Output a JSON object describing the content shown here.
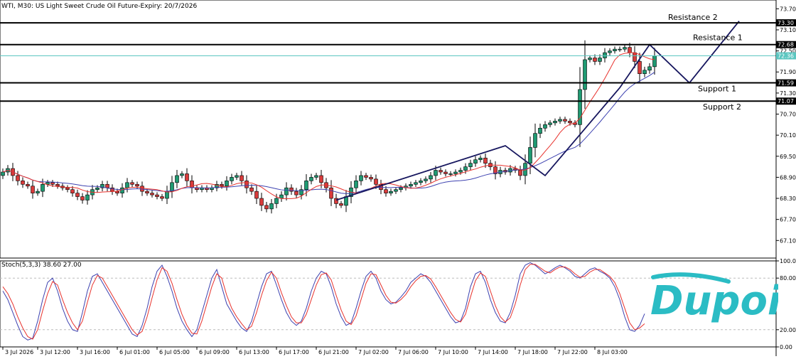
{
  "chart_data": [
    {
      "type": "candlestick",
      "title": "WTI, M30:  US Light Sweet Crude Oil Future-Expiry: 20/7/2026",
      "price_axis": {
        "ylim": [
          66.6,
          73.95
        ],
        "ticks": [
          "73.70",
          "73.10",
          "72.50",
          "71.90",
          "71.30",
          "70.70",
          "70.10",
          "69.50",
          "68.90",
          "68.30",
          "67.70",
          "67.10"
        ]
      },
      "time_axis": {
        "labels": [
          "3 Jul 2026",
          "3 Jul 12:00",
          "3 Jul 16:00",
          "6 Jul 01:00",
          "6 Jul 05:00",
          "6 Jul 09:00",
          "6 Jul 13:00",
          "6 Jul 17:00",
          "6 Jul 21:00",
          "7 Jul 02:00",
          "7 Jul 06:00",
          "7 Jul 10:00",
          "7 Jul 14:00",
          "7 Jul 18:00",
          "7 Jul 22:00",
          "8 Jul 03:00"
        ],
        "label_bar_index": [
          0,
          7,
          15,
          23,
          31,
          39,
          47,
          55,
          63,
          71,
          79,
          87,
          95,
          103,
          111,
          119
        ]
      },
      "levels": [
        {
          "name": "Resistance 2",
          "value": 73.3,
          "label": "73.30",
          "color": "#000000"
        },
        {
          "name": "Resistance 1",
          "value": 72.68,
          "label": "72.68",
          "color": "#000000"
        },
        {
          "name": "Support 1",
          "value": 71.59,
          "label": "71.59",
          "color": "#000000"
        },
        {
          "name": "Support 2",
          "value": 71.07,
          "label": "71.07",
          "color": "#000000"
        }
      ],
      "current_price": {
        "value": 72.36,
        "label": "72.36",
        "color": "#5cc6c0"
      },
      "candles_close": [
        69.05,
        69.15,
        68.95,
        68.8,
        68.7,
        68.65,
        68.45,
        68.5,
        68.7,
        68.75,
        68.7,
        68.65,
        68.6,
        68.55,
        68.45,
        68.35,
        68.25,
        68.4,
        68.55,
        68.6,
        68.7,
        68.6,
        68.5,
        68.45,
        68.6,
        68.75,
        68.7,
        68.65,
        68.5,
        68.45,
        68.4,
        68.35,
        68.3,
        68.5,
        68.75,
        68.95,
        69.0,
        68.8,
        68.6,
        68.55,
        68.6,
        68.55,
        68.6,
        68.7,
        68.65,
        68.8,
        68.9,
        68.95,
        68.8,
        68.6,
        68.5,
        68.3,
        68.1,
        68.0,
        68.15,
        68.3,
        68.4,
        68.6,
        68.5,
        68.4,
        68.55,
        68.8,
        68.9,
        68.95,
        68.75,
        68.6,
        68.3,
        68.15,
        68.1,
        68.35,
        68.6,
        68.8,
        68.95,
        68.9,
        68.85,
        68.7,
        68.55,
        68.45,
        68.5,
        68.55,
        68.6,
        68.65,
        68.7,
        68.75,
        68.8,
        68.85,
        68.95,
        69.1,
        69.05,
        69.0,
        69.0,
        69.05,
        69.1,
        69.2,
        69.3,
        69.4,
        69.45,
        69.3,
        69.2,
        69.0,
        69.1,
        69.05,
        69.15,
        69.1,
        68.95,
        69.3,
        69.75,
        70.15,
        70.3,
        70.4,
        70.45,
        70.5,
        70.55,
        70.5,
        70.45,
        70.4,
        71.4,
        72.25,
        72.3,
        72.2,
        72.3,
        72.45,
        72.5,
        72.55,
        72.55,
        72.6,
        72.45,
        72.2,
        71.85,
        71.95,
        72.05,
        72.36
      ],
      "ma_fast": {
        "name": "",
        "color": "#e8322d"
      },
      "ma_slow": {
        "name": "",
        "color": "#3d42b0"
      },
      "pattern_line": {
        "color": "#16165e",
        "points": [
          [
            67,
            68.25
          ],
          [
            101,
            69.8
          ],
          [
            109,
            68.95
          ],
          [
            124,
            71.45
          ],
          [
            130,
            72.68
          ],
          [
            138,
            71.59
          ],
          [
            148,
            73.35
          ]
        ]
      }
    },
    {
      "type": "line",
      "title": "Stoch(5,3,3) 38.60 27.00",
      "ylim": [
        0,
        100
      ],
      "ticks": [
        "100.00",
        "80.00",
        "20.00",
        "0.00"
      ],
      "level_lines": [
        80,
        20
      ],
      "series": [
        {
          "name": "",
          "color": "#3d42b0",
          "values": [
            65,
            55,
            40,
            25,
            12,
            8,
            10,
            30,
            55,
            75,
            80,
            65,
            45,
            30,
            20,
            18,
            40,
            65,
            82,
            85,
            75,
            65,
            55,
            45,
            35,
            25,
            15,
            12,
            25,
            45,
            70,
            88,
            95,
            82,
            65,
            45,
            30,
            20,
            12,
            20,
            40,
            60,
            80,
            90,
            70,
            50,
            40,
            30,
            22,
            18,
            30,
            50,
            70,
            85,
            88,
            72,
            55,
            40,
            30,
            25,
            30,
            45,
            65,
            80,
            88,
            85,
            70,
            50,
            35,
            25,
            28,
            45,
            65,
            82,
            88,
            80,
            65,
            55,
            50,
            52,
            58,
            65,
            75,
            80,
            85,
            82,
            75,
            65,
            55,
            45,
            35,
            28,
            30,
            45,
            70,
            85,
            88,
            75,
            55,
            40,
            30,
            28,
            40,
            60,
            85,
            95,
            98,
            95,
            90,
            85,
            88,
            92,
            95,
            92,
            88,
            82,
            80,
            85,
            90,
            92,
            88,
            85,
            80,
            70,
            55,
            35,
            20,
            18,
            25,
            38.6
          ]
        },
        {
          "name": "",
          "color": "#e8322d",
          "values": [
            70,
            62,
            50,
            35,
            22,
            12,
            9,
            20,
            42,
            62,
            76,
            72,
            55,
            40,
            28,
            20,
            30,
            52,
            72,
            83,
            80,
            70,
            60,
            50,
            40,
            30,
            20,
            14,
            18,
            35,
            57,
            78,
            92,
            88,
            74,
            55,
            38,
            25,
            16,
            15,
            30,
            50,
            70,
            85,
            80,
            60,
            45,
            35,
            27,
            20,
            24,
            40,
            60,
            77,
            87,
            80,
            63,
            48,
            35,
            28,
            28,
            38,
            55,
            72,
            84,
            86,
            78,
            60,
            43,
            30,
            26,
            36,
            55,
            74,
            85,
            84,
            72,
            60,
            52,
            51,
            55,
            61,
            70,
            77,
            82,
            83,
            79,
            70,
            60,
            50,
            40,
            32,
            29,
            38,
            58,
            77,
            86,
            82,
            65,
            48,
            35,
            29,
            34,
            50,
            72,
            90,
            96,
            96,
            92,
            88,
            86,
            90,
            93,
            93,
            90,
            85,
            81,
            82,
            87,
            90,
            90,
            86,
            82,
            75,
            62,
            45,
            28,
            20,
            22,
            27.0
          ]
        }
      ]
    }
  ],
  "brand": {
    "logo_text": "Dupoin",
    "color": "#2bbcc4"
  }
}
